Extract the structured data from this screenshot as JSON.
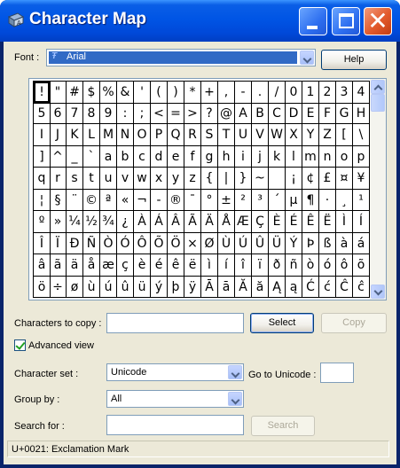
{
  "window": {
    "title": "Character Map"
  },
  "font": {
    "label": "Font :",
    "value": "Arial",
    "icon": "truetype-font-icon"
  },
  "help_button": "Help",
  "grid": {
    "selected": "!",
    "rows": [
      [
        "!",
        "\"",
        "#",
        "$",
        "%",
        "&",
        "'",
        "(",
        ")",
        "*",
        "+",
        ",",
        "-",
        ".",
        "/",
        "0",
        "1",
        "2",
        "3",
        "4"
      ],
      [
        "5",
        "6",
        "7",
        "8",
        "9",
        ":",
        ";",
        "<",
        "=",
        ">",
        "?",
        "@",
        "A",
        "B",
        "C",
        "D",
        "E",
        "F",
        "G",
        "H"
      ],
      [
        "I",
        "J",
        "K",
        "L",
        "M",
        "N",
        "O",
        "P",
        "Q",
        "R",
        "S",
        "T",
        "U",
        "V",
        "W",
        "X",
        "Y",
        "Z",
        "[",
        "\\"
      ],
      [
        "]",
        "^",
        "_",
        "`",
        "a",
        "b",
        "c",
        "d",
        "e",
        "f",
        "g",
        "h",
        "i",
        "j",
        "k",
        "l",
        "m",
        "n",
        "o",
        "p"
      ],
      [
        "q",
        "r",
        "s",
        "t",
        "u",
        "v",
        "w",
        "x",
        "y",
        "z",
        "{",
        "|",
        "}",
        "~",
        " ",
        "¡",
        "¢",
        "£",
        "¤",
        "¥"
      ],
      [
        "¦",
        "§",
        "¨",
        "©",
        "ª",
        "«",
        "¬",
        "-",
        "®",
        "¯",
        "°",
        "±",
        "²",
        "³",
        "´",
        "µ",
        "¶",
        "·",
        "¸",
        "¹"
      ],
      [
        "º",
        "»",
        "¼",
        "½",
        "¾",
        "¿",
        "À",
        "Á",
        "Â",
        "Ã",
        "Ä",
        "Å",
        "Æ",
        "Ç",
        "È",
        "É",
        "Ê",
        "Ë",
        "Ì",
        "Í"
      ],
      [
        "Î",
        "Ï",
        "Ð",
        "Ñ",
        "Ò",
        "Ó",
        "Ô",
        "Õ",
        "Ö",
        "×",
        "Ø",
        "Ù",
        "Ú",
        "Û",
        "Ü",
        "Ý",
        "Þ",
        "ß",
        "à",
        "á"
      ],
      [
        "â",
        "ã",
        "ä",
        "å",
        "æ",
        "ç",
        "è",
        "é",
        "ê",
        "ë",
        "ì",
        "í",
        "î",
        "ï",
        "ð",
        "ñ",
        "ò",
        "ó",
        "ô",
        "õ"
      ],
      [
        "ö",
        "÷",
        "ø",
        "ù",
        "ú",
        "û",
        "ü",
        "ý",
        "þ",
        "ÿ",
        "Ā",
        "ā",
        "Ă",
        "ă",
        "Ą",
        "ą",
        "Ć",
        "ć",
        "Ĉ",
        "ĉ"
      ]
    ]
  },
  "copy": {
    "label": "Characters to copy :",
    "value": "",
    "select_button": "Select",
    "copy_button": "Copy"
  },
  "advanced": {
    "label": "Advanced view",
    "checked": true
  },
  "character_set": {
    "label": "Character set :",
    "value": "Unicode"
  },
  "goto_unicode": {
    "label": "Go to Unicode :",
    "value": ""
  },
  "group_by": {
    "label": "Group by :",
    "value": "All"
  },
  "search": {
    "label": "Search for :",
    "value": "",
    "button": "Search"
  },
  "status": "U+0021: Exclamation Mark",
  "colors": {
    "titlebar": "#0055e5",
    "client": "#ece9d8",
    "selection": "#316ac5",
    "close": "#e25a2c"
  }
}
